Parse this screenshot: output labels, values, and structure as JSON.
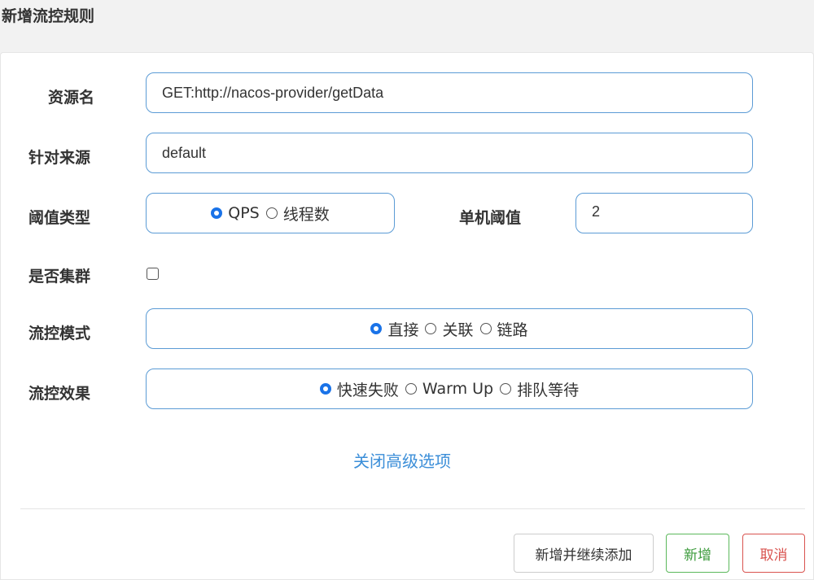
{
  "dialog": {
    "title": "新增流控规则"
  },
  "form": {
    "resource": {
      "label": "资源名",
      "value": "GET:http://nacos-provider/getData"
    },
    "limit_app": {
      "label": "针对来源",
      "value": "default"
    },
    "grade": {
      "label": "阈值类型",
      "options": [
        {
          "label": "QPS",
          "checked": true
        },
        {
          "label": "线程数",
          "checked": false
        }
      ]
    },
    "count": {
      "label": "单机阈值",
      "value": "2"
    },
    "cluster": {
      "label": "是否集群",
      "checked": false
    },
    "strategy": {
      "label": "流控模式",
      "options": [
        {
          "label": "直接",
          "checked": true
        },
        {
          "label": "关联",
          "checked": false
        },
        {
          "label": "链路",
          "checked": false
        }
      ]
    },
    "control_behavior": {
      "label": "流控效果",
      "options": [
        {
          "label": "快速失败",
          "checked": true
        },
        {
          "label": "Warm Up",
          "checked": false
        },
        {
          "label": "排队等待",
          "checked": false
        }
      ]
    },
    "advanced_toggle": "关闭高级选项"
  },
  "footer": {
    "add_continue": "新增并继续添加",
    "add": "新增",
    "cancel": "取消"
  }
}
